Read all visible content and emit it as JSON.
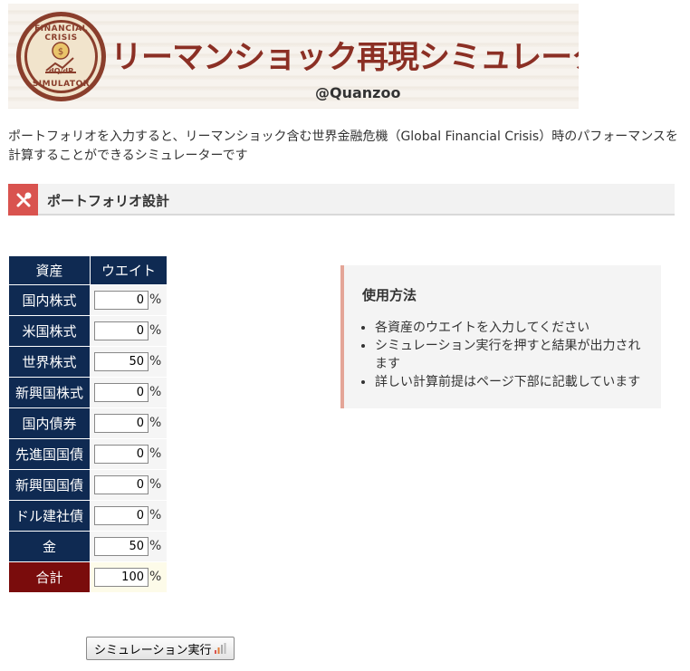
{
  "banner": {
    "logo": {
      "top_text": "FINANCIAL CRISIS",
      "bottom_text": "SIMULATOR",
      "center_text": "dQ/dP"
    },
    "title": "リーマンショック再現シミュレーター",
    "handle": "@Quanzoo"
  },
  "intro": "ポートフォリオを入力すると、リーマンショック含む世界金融危機（Global Financial Crisis）時のパフォーマンスを計算することができるシミュレーターです",
  "section": {
    "title": "ポートフォリオ設計",
    "icon": "tools-icon",
    "accent_color": "#d9534f"
  },
  "table": {
    "headers": {
      "asset": "資産",
      "weight": "ウエイト"
    },
    "unit": "%",
    "rows": [
      {
        "asset": "国内株式",
        "weight": "0"
      },
      {
        "asset": "米国株式",
        "weight": "0"
      },
      {
        "asset": "世界株式",
        "weight": "50"
      },
      {
        "asset": "新興国株式",
        "weight": "0"
      },
      {
        "asset": "国内債券",
        "weight": "0"
      },
      {
        "asset": "先進国国債",
        "weight": "0"
      },
      {
        "asset": "新興国国債",
        "weight": "0"
      },
      {
        "asset": "ドル建社債",
        "weight": "0"
      },
      {
        "asset": "金",
        "weight": "50"
      }
    ],
    "total": {
      "asset": "合計",
      "weight": "100"
    },
    "header_color": "#0f2a52",
    "total_color": "#7a0c0c"
  },
  "usage": {
    "title": "使用方法",
    "items": [
      "各資産のウエイトを入力してください",
      "シミュレーション実行を押すと結果が出力されます",
      "詳しい計算前提はページ下部に記載しています"
    ]
  },
  "run_button": {
    "label": "シミュレーション実行",
    "icon": "chart-bars-icon"
  }
}
